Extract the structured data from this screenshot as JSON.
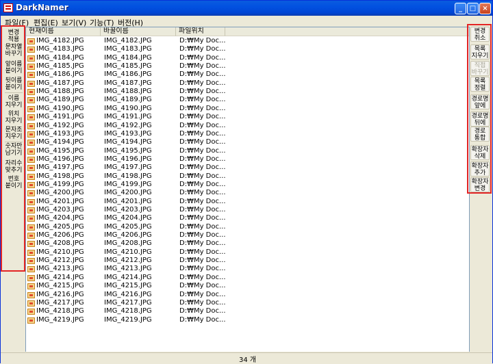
{
  "window": {
    "title": "DarkNamer"
  },
  "menu": [
    "파일(F)",
    "편집(E)",
    "보기(V)",
    "기능(T)",
    "버전(H)"
  ],
  "left_buttons": [
    "변경\n적용",
    "문자열\n바꾸기",
    "앞이름\n붙이기",
    "뒷이름\n붙이기",
    "이름\n지우기",
    "위치\n지우기",
    "문자조\n지우기",
    "숫자만\n남기기",
    "자리수\n맞추기",
    "번호\n붙이기"
  ],
  "columns": [
    "현재이름",
    "바꿀이름",
    "파일위치"
  ],
  "rows": [
    [
      "IMG_4182.JPG",
      "IMG_4182.JPG",
      "D:₩My Doc..."
    ],
    [
      "IMG_4183.JPG",
      "IMG_4183.JPG",
      "D:₩My Doc..."
    ],
    [
      "IMG_4184.JPG",
      "IMG_4184.JPG",
      "D:₩My Doc..."
    ],
    [
      "IMG_4185.JPG",
      "IMG_4185.JPG",
      "D:₩My Doc..."
    ],
    [
      "IMG_4186.JPG",
      "IMG_4186.JPG",
      "D:₩My Doc..."
    ],
    [
      "IMG_4187.JPG",
      "IMG_4187.JPG",
      "D:₩My Doc..."
    ],
    [
      "IMG_4188.JPG",
      "IMG_4188.JPG",
      "D:₩My Doc..."
    ],
    [
      "IMG_4189.JPG",
      "IMG_4189.JPG",
      "D:₩My Doc..."
    ],
    [
      "IMG_4190.JPG",
      "IMG_4190.JPG",
      "D:₩My Doc..."
    ],
    [
      "IMG_4191.JPG",
      "IMG_4191.JPG",
      "D:₩My Doc..."
    ],
    [
      "IMG_4192.JPG",
      "IMG_4192.JPG",
      "D:₩My Doc..."
    ],
    [
      "IMG_4193.JPG",
      "IMG_4193.JPG",
      "D:₩My Doc..."
    ],
    [
      "IMG_4194.JPG",
      "IMG_4194.JPG",
      "D:₩My Doc..."
    ],
    [
      "IMG_4195.JPG",
      "IMG_4195.JPG",
      "D:₩My Doc..."
    ],
    [
      "IMG_4196.JPG",
      "IMG_4196.JPG",
      "D:₩My Doc..."
    ],
    [
      "IMG_4197.JPG",
      "IMG_4197.JPG",
      "D:₩My Doc..."
    ],
    [
      "IMG_4198.JPG",
      "IMG_4198.JPG",
      "D:₩My Doc..."
    ],
    [
      "IMG_4199.JPG",
      "IMG_4199.JPG",
      "D:₩My Doc..."
    ],
    [
      "IMG_4200.JPG",
      "IMG_4200.JPG",
      "D:₩My Doc..."
    ],
    [
      "IMG_4201.JPG",
      "IMG_4201.JPG",
      "D:₩My Doc..."
    ],
    [
      "IMG_4203.JPG",
      "IMG_4203.JPG",
      "D:₩My Doc..."
    ],
    [
      "IMG_4204.JPG",
      "IMG_4204.JPG",
      "D:₩My Doc..."
    ],
    [
      "IMG_4205.JPG",
      "IMG_4205.JPG",
      "D:₩My Doc..."
    ],
    [
      "IMG_4206.JPG",
      "IMG_4206.JPG",
      "D:₩My Doc..."
    ],
    [
      "IMG_4208.JPG",
      "IMG_4208.JPG",
      "D:₩My Doc..."
    ],
    [
      "IMG_4210.JPG",
      "IMG_4210.JPG",
      "D:₩My Doc..."
    ],
    [
      "IMG_4212.JPG",
      "IMG_4212.JPG",
      "D:₩My Doc..."
    ],
    [
      "IMG_4213.JPG",
      "IMG_4213.JPG",
      "D:₩My Doc..."
    ],
    [
      "IMG_4214.JPG",
      "IMG_4214.JPG",
      "D:₩My Doc..."
    ],
    [
      "IMG_4215.JPG",
      "IMG_4215.JPG",
      "D:₩My Doc..."
    ],
    [
      "IMG_4216.JPG",
      "IMG_4216.JPG",
      "D:₩My Doc..."
    ],
    [
      "IMG_4217.JPG",
      "IMG_4217.JPG",
      "D:₩My Doc..."
    ],
    [
      "IMG_4218.JPG",
      "IMG_4218.JPG",
      "D:₩My Doc..."
    ],
    [
      "IMG_4219.JPG",
      "IMG_4219.JPG",
      "D:₩My Doc..."
    ]
  ],
  "right_buttons": [
    {
      "label": "변경\n취소",
      "disabled": false
    },
    {
      "label": "목록\n지우기",
      "disabled": false
    },
    {
      "label": "직접\n바꾸기",
      "disabled": true
    },
    {
      "label": "목록\n정렬",
      "disabled": false
    },
    {
      "label": "경로명\n앞에",
      "disabled": false
    },
    {
      "label": "경로명\n뒤에",
      "disabled": false
    },
    {
      "label": "경로\n통합",
      "disabled": false
    },
    {
      "label": "확장자\n삭제",
      "disabled": false
    },
    {
      "label": "확장자\n추가",
      "disabled": false
    },
    {
      "label": "확장자\n변경",
      "disabled": false
    }
  ],
  "status": {
    "count": "34 개"
  },
  "colors": {
    "highlight_border": "#E32424",
    "titlebar": "#0251E0"
  },
  "icons": {
    "titlebar_buttons": [
      "minimize-icon",
      "maximize-icon",
      "close-icon"
    ],
    "file": "jpg-file-icon"
  }
}
